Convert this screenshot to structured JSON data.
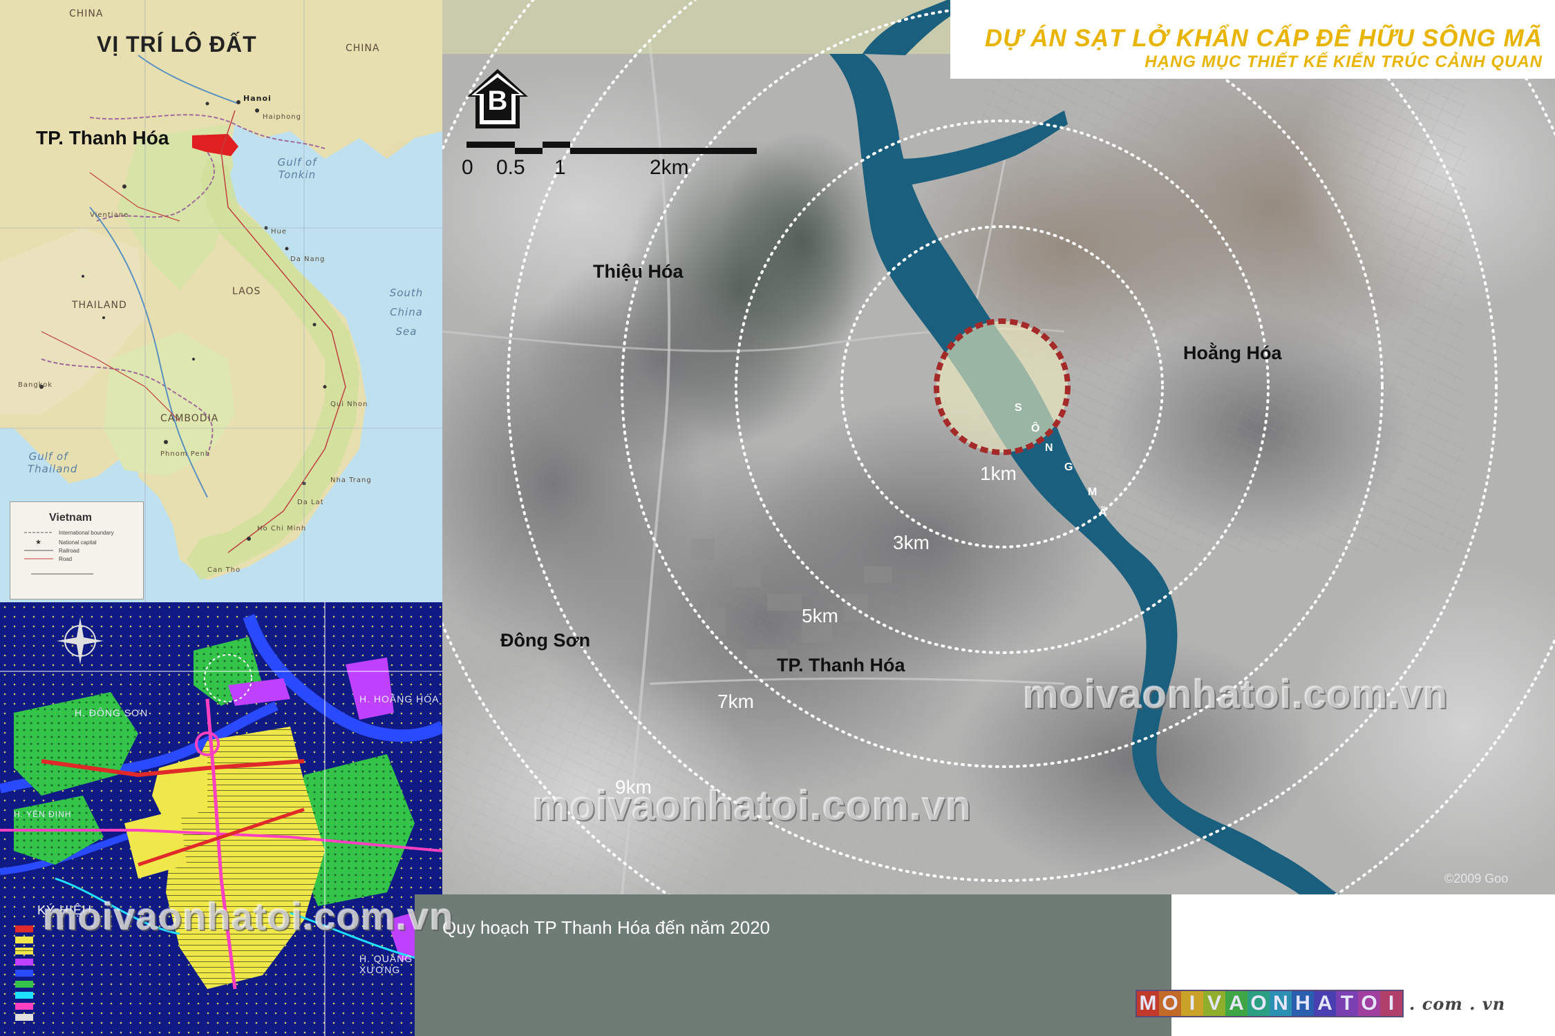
{
  "header": {
    "title": "DỰ ÁN SẠT LỞ KHẨN CẤP ĐÊ HỮU SÔNG MÃ",
    "subtitle": "HẠNG MỤC THIẾT KẾ KIẾN TRÚC CẢNH QUAN"
  },
  "location_map": {
    "title": "VỊ TRÍ LÔ ĐẤT",
    "city_label": "TP. Thanh Hóa",
    "countries": [
      "CHINA",
      "CHINA",
      "LAOS",
      "THAILAND",
      "CAMBODIA"
    ],
    "seas": [
      "Gulf of Tonkin",
      "South China Sea",
      "Gulf of Thailand"
    ],
    "cities": [
      "Hanoi",
      "Haiphong",
      "Vientiane",
      "Hue",
      "Da Nang",
      "Phnom Penh",
      "Ho Chi Minh",
      "Can Tho",
      "Bangkok",
      "Nha Trang",
      "Da Lat",
      "Qui Nhon"
    ],
    "legend": {
      "title": "Vietnam",
      "items": [
        "International boundary",
        "National capital",
        "Railroad",
        "Road"
      ]
    }
  },
  "planning_map": {
    "legend_title": "KÝ HIỆU",
    "labels": [
      "H. ĐÔNG SƠN",
      "H. HOẰNG HÓA",
      "H. QUẢNG XƯƠNG",
      "H. YÊN ĐỊNH"
    ]
  },
  "satellite": {
    "north_letter": "B",
    "scale": [
      "0",
      "0.5",
      "1",
      "2km"
    ],
    "places": {
      "thieu_hoa": "Thiệu Hóa",
      "hoang_hoa": "Hoằng Hóa",
      "dong_son": "Đông Sơn",
      "thanh_hoa": "TP. Thanh Hóa"
    },
    "rings": [
      "1km",
      "3km",
      "5km",
      "7km",
      "9km"
    ],
    "river_label": [
      "S",
      "Ô",
      "N",
      "G",
      "M",
      "Ã"
    ],
    "watermarks": [
      "moivaonhatoi.com.vn",
      "moivaonhatoi.com.vn",
      "moivaonhatoi.com.vn"
    ],
    "imagery_credit": "©2009 Goo"
  },
  "caption": "Quy hoạch TP Thanh Hóa đến năm 2020",
  "logo": {
    "letters": [
      "M",
      "O",
      "I",
      "V",
      "A",
      "O",
      "N",
      "H",
      "A",
      "T",
      "O",
      "I"
    ],
    "colors": [
      "#c0392b",
      "#c26a2a",
      "#c9a227",
      "#8fae2b",
      "#3fa545",
      "#2aa080",
      "#2a8fb0",
      "#2a5fb0",
      "#4a3fb0",
      "#7a3fb0",
      "#a03fa0",
      "#b03f6a"
    ],
    "suffix": ". com . vn"
  },
  "colors": {
    "accent_title": "#e8b400",
    "river": "#1a5f7e",
    "site_circle": "#a42a2a",
    "caption_panel": "#6f7c76"
  }
}
